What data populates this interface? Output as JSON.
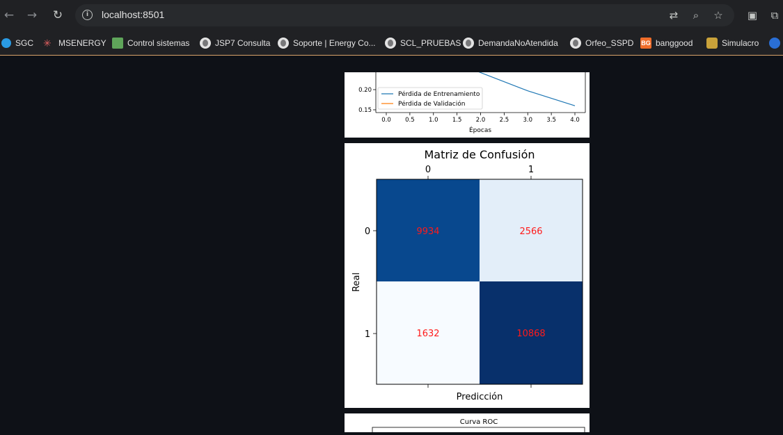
{
  "browser": {
    "url": "localhost:8501",
    "bookmarks": [
      {
        "label": "SGC",
        "icon": "sgc-icon"
      },
      {
        "label": "MSENERGY",
        "icon": "msenergy-icon"
      },
      {
        "label": "Control sistemas",
        "icon": "control-icon"
      },
      {
        "label": "JSP7 Consulta",
        "icon": "globe-icon"
      },
      {
        "label": "Soporte | Energy Co...",
        "icon": "globe-icon"
      },
      {
        "label": "SCL_PRUEBAS",
        "icon": "globe-icon"
      },
      {
        "label": "DemandaNoAtendida",
        "icon": "globe-icon"
      },
      {
        "label": "Orfeo_SSPD",
        "icon": "globe-icon"
      },
      {
        "label": "banggood",
        "icon": "banggood-icon",
        "badge": "BG"
      },
      {
        "label": "Simulacro",
        "icon": "simulacro-icon"
      }
    ]
  },
  "loss_chart": {
    "type": "line",
    "xlabel": "Épocas",
    "xticks": [
      "0.0",
      "0.5",
      "1.0",
      "1.5",
      "2.0",
      "2.5",
      "3.0",
      "3.5",
      "4.0"
    ],
    "yticks": [
      "0.15",
      "0.20"
    ],
    "legend": [
      "Pérdida de Entrenamiento",
      "Pérdida de Validación"
    ],
    "colors": [
      "#1f77b4",
      "#ff7f0e"
    ],
    "visible_series": {
      "x": [
        1.94,
        3.0,
        4.0
      ],
      "y": [
        0.245,
        0.197,
        0.16
      ]
    }
  },
  "confusion": {
    "title": "Matriz de Confusión",
    "xlabel": "Predicción",
    "ylabel": "Real",
    "col_labels": [
      "0",
      "1"
    ],
    "row_labels": [
      "0",
      "1"
    ],
    "cells": [
      [
        "9934",
        "2566"
      ],
      [
        "1632",
        "10868"
      ]
    ],
    "cell_colors": [
      [
        "#08488e",
        "#e3eef9"
      ],
      [
        "#f7fbff",
        "#08306b"
      ]
    ],
    "text_color": "#ff1a1a"
  },
  "roc": {
    "title": "Curva ROC"
  }
}
